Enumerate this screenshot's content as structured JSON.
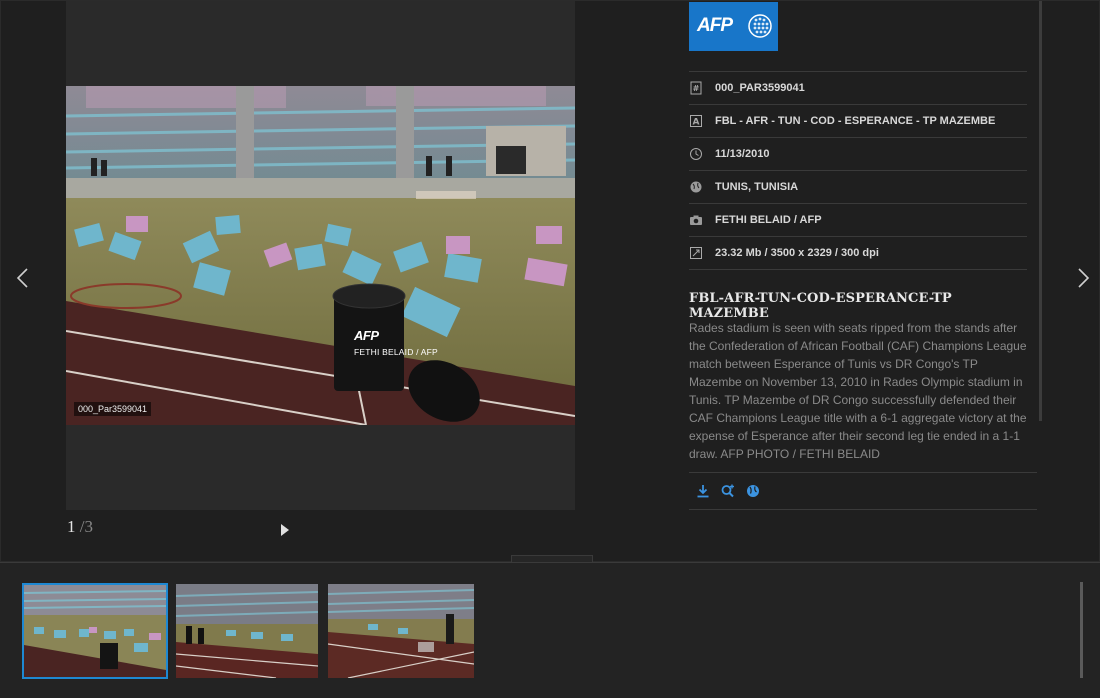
{
  "photo": {
    "id_label": "000_Par3599041",
    "watermark_logo": "AFP",
    "watermark_credit": "FETHI BELAID / AFP"
  },
  "pager": {
    "current": "1",
    "total": "/3"
  },
  "brand": {
    "logo_text": "AFP",
    "color": "#1876c9"
  },
  "meta": [
    {
      "icon": "hash-icon",
      "value": "000_PAR3599041"
    },
    {
      "icon": "letter-a-icon",
      "value": "FBL - AFR - TUN - COD - ESPERANCE - TP MAZEMBE"
    },
    {
      "icon": "clock-icon",
      "value": "11/13/2010"
    },
    {
      "icon": "globe-icon",
      "value": "TUNIS, TUNISIA"
    },
    {
      "icon": "camera-icon",
      "value": "FETHI BELAID / AFP"
    },
    {
      "icon": "resize-icon",
      "value": "23.32 Mb / 3500 x 2329 / 300 dpi"
    }
  ],
  "caption": {
    "title": "FBL-AFR-TUN-COD-ESPERANCE-TP MAZEMBE",
    "body": "Rades stadium is seen with seats ripped from the stands after the Confederation of African Football (CAF) Champions League match between Esperance of Tunis vs DR Congo's TP Mazembe on November 13, 2010 in Rades Olympic stadium in Tunis. TP Mazembe of DR Congo successfully defended their CAF Champions League title with a 6-1 aggregate victory at the expense of Esperance after their second leg tie ended in a 1-1 draw. AFP PHOTO / FETHI BELAID"
  },
  "actions": [
    "download-icon",
    "zoom-icon",
    "globe-icon"
  ],
  "colors": {
    "accent": "#1e88d2",
    "background": "#1f1f1f"
  }
}
